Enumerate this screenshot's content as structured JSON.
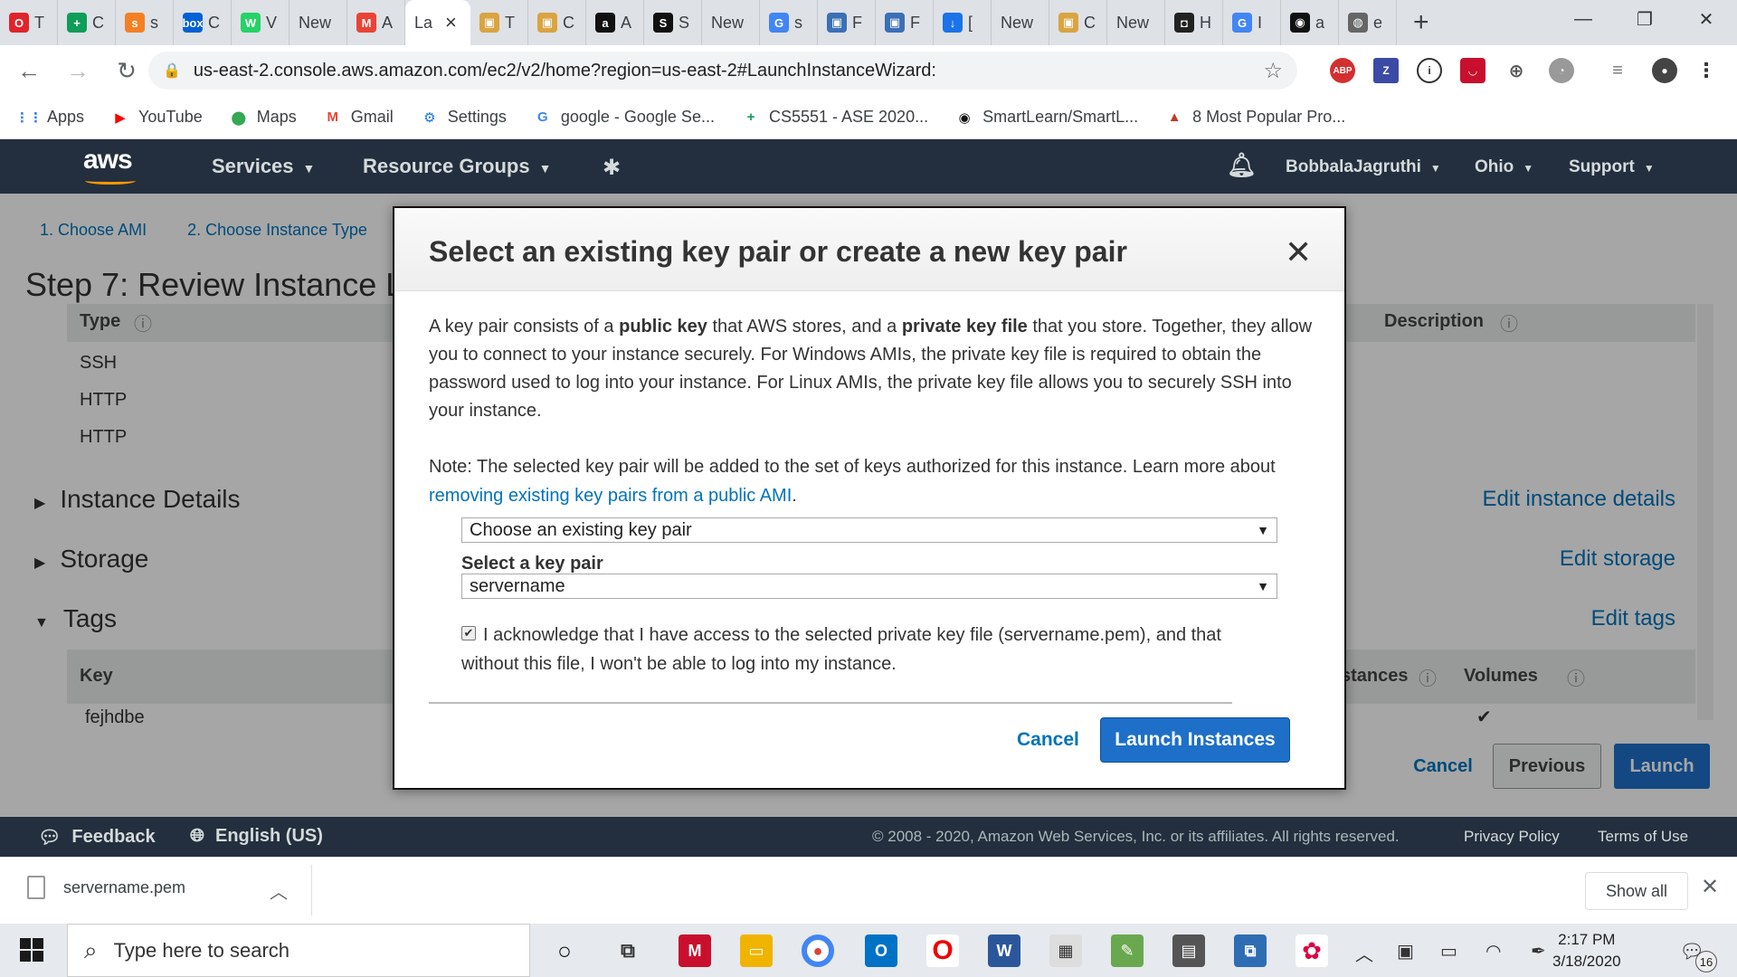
{
  "browser": {
    "tabs": [
      {
        "fav": "O",
        "color": "#e0242b",
        "text": "T"
      },
      {
        "fav": "+",
        "color": "#0f9d58",
        "text": "C"
      },
      {
        "fav": "s",
        "color": "#f48024",
        "text": "s"
      },
      {
        "fav": "box",
        "color": "#0061d5",
        "text": "C"
      },
      {
        "fav": "W",
        "color": "#25d366",
        "text": "V"
      },
      {
        "fav": "",
        "color": "",
        "text": "New"
      },
      {
        "fav": "M",
        "color": "#ea4335",
        "text": "A"
      },
      {
        "fav": "",
        "color": "",
        "text": "La",
        "active": true
      },
      {
        "fav": "▣",
        "color": "#d9a441",
        "text": "T"
      },
      {
        "fav": "▣",
        "color": "#d9a441",
        "text": "C"
      },
      {
        "fav": "a",
        "color": "#111111",
        "text": "A"
      },
      {
        "fav": "S",
        "color": "#111111",
        "text": "S"
      },
      {
        "fav": "",
        "color": "",
        "text": "New"
      },
      {
        "fav": "G",
        "color": "#4285f4",
        "text": "s"
      },
      {
        "fav": "▣",
        "color": "#3b6fb6",
        "text": "F"
      },
      {
        "fav": "▣",
        "color": "#3b6fb6",
        "text": "F"
      },
      {
        "fav": "↓",
        "color": "#1a73e8",
        "text": "["
      },
      {
        "fav": "",
        "color": "",
        "text": "New"
      },
      {
        "fav": "▣",
        "color": "#d9a441",
        "text": "C"
      },
      {
        "fav": "",
        "color": "",
        "text": "New"
      },
      {
        "fav": "◘",
        "color": "#222222",
        "text": "H"
      },
      {
        "fav": "G",
        "color": "#4285f4",
        "text": "I"
      },
      {
        "fav": "◉",
        "color": "#111111",
        "text": "a"
      },
      {
        "fav": "◍",
        "color": "#666666",
        "text": "e"
      }
    ],
    "url": "us-east-2.console.aws.amazon.com/ec2/v2/home?region=us-east-2#LaunchInstanceWizard:",
    "bookmarks": [
      {
        "label": "Apps",
        "icon": "⋮⋮",
        "color": "#4285f4"
      },
      {
        "label": "YouTube",
        "icon": "▶",
        "color": "#ff0000"
      },
      {
        "label": "Maps",
        "icon": "⬤",
        "color": "#34a853"
      },
      {
        "label": "Gmail",
        "icon": "M",
        "color": "#ea4335"
      },
      {
        "label": "Settings",
        "icon": "⚙",
        "color": "#1a73e8"
      },
      {
        "label": "google - Google Se...",
        "icon": "G",
        "color": "#4285f4"
      },
      {
        "label": "CS5551 - ASE 2020...",
        "icon": "+",
        "color": "#0f9d58"
      },
      {
        "label": "SmartLearn/SmartL...",
        "icon": "◉",
        "color": "#111111"
      },
      {
        "label": "8 Most Popular Pro...",
        "icon": "▲",
        "color": "#c0392b"
      }
    ]
  },
  "aws": {
    "logo": "aws",
    "services": "Services",
    "resource_groups": "Resource Groups",
    "user": "BobbalaJagruthi",
    "region": "Ohio",
    "support": "Support"
  },
  "page": {
    "step1": "1. Choose AMI",
    "step2": "2. Choose Instance Type",
    "title": "Step 7: Review Instance L",
    "col_type": "Type",
    "col_description": "Description",
    "rows": [
      "SSH",
      "HTTP",
      "HTTP"
    ],
    "instance_details": "Instance Details",
    "edit_instance_details": "Edit instance details",
    "storage": "Storage",
    "edit_storage": "Edit storage",
    "tags": "Tags",
    "edit_tags": "Edit tags",
    "col_key": "Key",
    "col_instances": "stances",
    "col_volumes": "Volumes",
    "tag_key": "fejhdbe",
    "cancel": "Cancel",
    "previous": "Previous",
    "launch": "Launch"
  },
  "footer": {
    "feedback": "Feedback",
    "language": "English (US)",
    "copyright": "© 2008 - 2020, Amazon Web Services, Inc. or its affiliates. All rights reserved.",
    "privacy": "Privacy Policy",
    "terms": "Terms of Use"
  },
  "modal": {
    "title": "Select an existing key pair or create a new key pair",
    "p1_a": "A key pair consists of a ",
    "p1_b": "public key",
    "p1_c": " that AWS stores, and a ",
    "p1_d": "private key file",
    "p1_e": " that you store. Together, they allow you to connect to your instance securely. For Windows AMIs, the private key file is required to obtain the password used to log into your instance. For Linux AMIs, the private key file allows you to securely SSH into your instance.",
    "note": "Note: The selected key pair will be added to the set of keys authorized for this instance. Learn more about ",
    "note_link": "removing existing key pairs from a public AMI",
    "note_end": ".",
    "choice_select": "Choose an existing key pair",
    "select_label": "Select a key pair",
    "keypair_select": "servername",
    "ack": "I acknowledge that I have access to the selected private key file (servername.pem), and that without this file, I won't be able to log into my instance.",
    "cancel": "Cancel",
    "launch": "Launch Instances"
  },
  "downloads": {
    "file": "servername.pem",
    "show_all": "Show all"
  },
  "taskbar": {
    "search_placeholder": "Type here to search",
    "time": "2:17 PM",
    "date": "3/18/2020",
    "notifications": "16"
  }
}
